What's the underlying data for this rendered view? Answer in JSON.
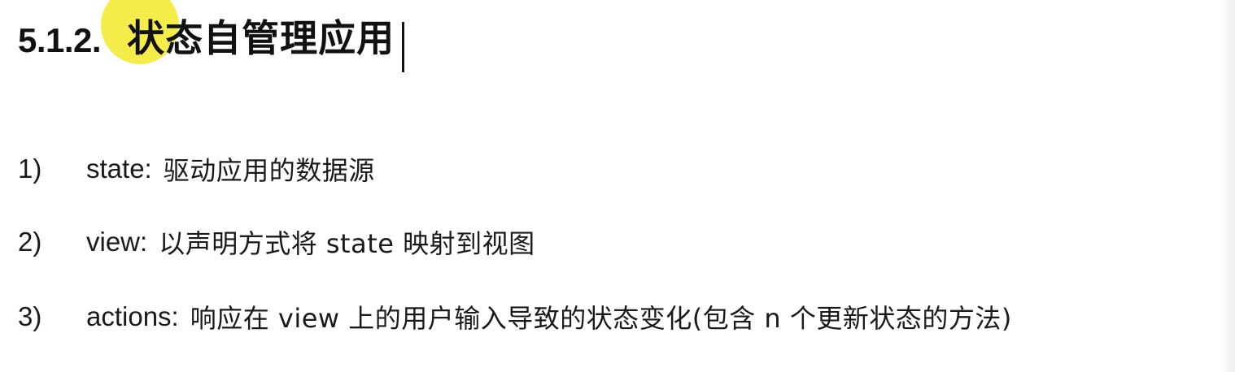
{
  "heading": {
    "number": "5.1.2.",
    "title": "状态自管理应用"
  },
  "list": [
    {
      "marker": "1)",
      "term": "state:",
      "description": "驱动应用的数据源"
    },
    {
      "marker": "2)",
      "term": "view:",
      "description": "以声明方式将 state 映射到视图"
    },
    {
      "marker": "3)",
      "term": "actions:",
      "description": "响应在 view 上的用户输入导致的状态变化(包含 n 个更新状态的方法)"
    }
  ],
  "colors": {
    "text": "#1a1a1a",
    "cursor_highlight": "#f3ec3a",
    "background": "#ffffff"
  }
}
